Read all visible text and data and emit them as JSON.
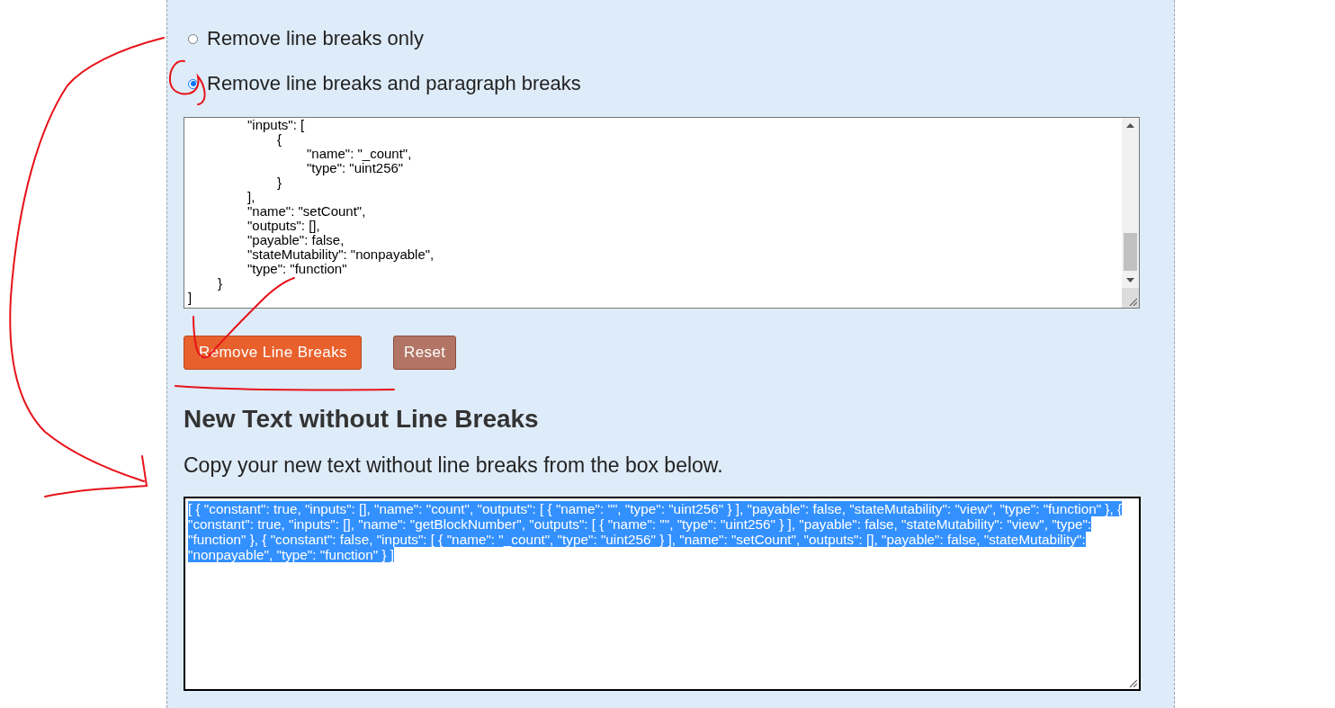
{
  "options": [
    {
      "label": "Remove line breaks only",
      "selected": false
    },
    {
      "label": "Remove line breaks and paragraph breaks",
      "selected": true
    }
  ],
  "input_text": "\t\t\"inputs\": [\n\t\t\t{\n\t\t\t\t\"name\": \"_count\",\n\t\t\t\t\"type\": \"uint256\"\n\t\t\t}\n\t\t],\n\t\t\"name\": \"setCount\",\n\t\t\"outputs\": [],\n\t\t\"payable\": false,\n\t\t\"stateMutability\": \"nonpayable\",\n\t\t\"type\": \"function\"\n\t}\n]",
  "buttons": [
    {
      "label": "Remove Line Breaks",
      "kind": "primary"
    },
    {
      "label": "Reset",
      "kind": "reset"
    }
  ],
  "result": {
    "heading": "New Text without Line Breaks",
    "instructions": "Copy your new text without line breaks from the box below.",
    "output_text": "[ { \"constant\": true, \"inputs\": [], \"name\": \"count\", \"outputs\": [ { \"name\": \"\", \"type\": \"uint256\" } ], \"payable\": false, \"stateMutability\": \"view\", \"type\": \"function\" }, { \"constant\": true, \"inputs\": [], \"name\": \"getBlockNumber\", \"outputs\": [ { \"name\": \"\", \"type\": \"uint256\" } ], \"payable\": false, \"stateMutability\": \"view\", \"type\": \"function\" }, { \"constant\": false, \"inputs\": [ { \"name\": \"_count\", \"type\": \"uint256\" } ], \"name\": \"setCount\", \"outputs\": [], \"payable\": false, \"stateMutability\": \"nonpayable\", \"type\": \"function\" } ]",
    "selected": true
  }
}
